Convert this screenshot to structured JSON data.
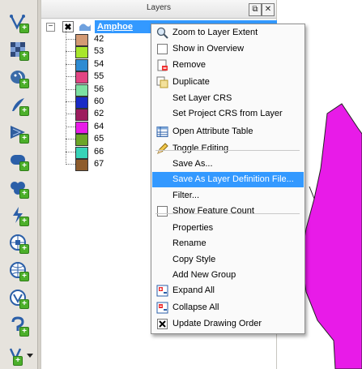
{
  "layers_panel": {
    "title": "Layers",
    "float_label": "⧉",
    "close_label": "✕",
    "layer": {
      "name": "Amphoe"
    },
    "legend": [
      {
        "label": "42",
        "color": "#d39a74"
      },
      {
        "label": "53",
        "color": "#a8e62c"
      },
      {
        "label": "54",
        "color": "#2e8bd2"
      },
      {
        "label": "55",
        "color": "#e24583"
      },
      {
        "label": "56",
        "color": "#7de0a2"
      },
      {
        "label": "60",
        "color": "#1a2bc6"
      },
      {
        "label": "62",
        "color": "#9d1c5e"
      },
      {
        "label": "64",
        "color": "#e81be8"
      },
      {
        "label": "65",
        "color": "#6ca527"
      },
      {
        "label": "66",
        "color": "#37d3b8"
      },
      {
        "label": "67",
        "color": "#8e5c2c"
      }
    ]
  },
  "context_menu": {
    "items": [
      {
        "label": "Zoom to Layer Extent",
        "icon": "zoom-icon"
      },
      {
        "label": "Show in Overview",
        "icon": "checkbox-icon"
      },
      {
        "label": "Remove",
        "icon": "remove-icon"
      },
      {
        "label": "Duplicate",
        "icon": "duplicate-icon"
      },
      {
        "label": "Set Layer CRS",
        "icon": ""
      },
      {
        "label": "Set Project CRS from Layer",
        "icon": ""
      },
      {
        "label": "Open Attribute Table",
        "icon": "table-icon"
      },
      {
        "label": "Toggle Editing",
        "icon": "pencil-icon"
      },
      {
        "label": "Save As...",
        "icon": ""
      },
      {
        "label": "Save As Layer Definition File...",
        "icon": "",
        "highlighted": true
      },
      {
        "label": "Filter...",
        "icon": ""
      },
      {
        "label": "Show Feature Count",
        "icon": "checkbox-icon"
      },
      {
        "label": "Properties",
        "icon": ""
      },
      {
        "label": "Rename",
        "icon": ""
      },
      {
        "label": "Copy Style",
        "icon": ""
      },
      {
        "label": "Add New Group",
        "icon": ""
      },
      {
        "label": "Expand All",
        "icon": "expand-icon"
      },
      {
        "label": "Collapse All",
        "icon": "collapse-icon"
      },
      {
        "label": "Update Drawing Order",
        "icon": "x-checkbox-icon"
      }
    ]
  },
  "toolbar": {
    "tools": [
      {
        "name": "add-vector-layer-icon"
      },
      {
        "name": "add-raster-layer-icon"
      },
      {
        "name": "add-postgis-layer-icon"
      },
      {
        "name": "add-spatialite-layer-icon"
      },
      {
        "name": "add-mssql-layer-icon"
      },
      {
        "name": "add-oracle-layer-icon"
      },
      {
        "name": "add-db2-layer-icon"
      },
      {
        "name": "add-wms-layer-icon"
      },
      {
        "name": "add-wcs-layer-icon"
      },
      {
        "name": "add-wfs-layer-icon"
      },
      {
        "name": "add-delimited-text-layer-icon"
      },
      {
        "name": "add-virtual-layer-icon"
      },
      {
        "name": "new-layer-dropdown-icon"
      }
    ]
  },
  "colors": {
    "highlight": "#3399ff",
    "map_polygon": "#e81be8"
  }
}
